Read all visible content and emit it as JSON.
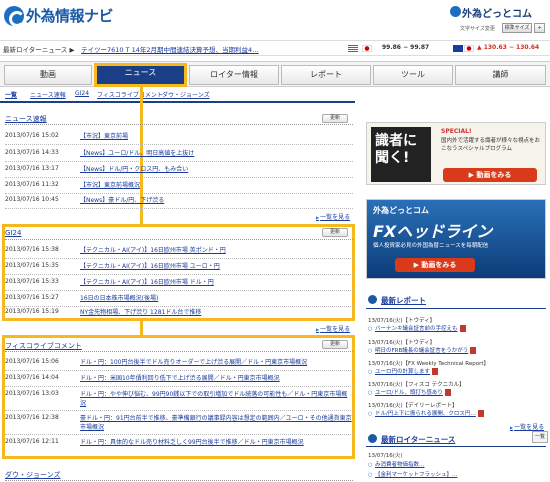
{
  "header": {
    "logo": "外為情報ナビ",
    "brand": "外為どっとコム",
    "fontsize_label": "文字サイズ変更",
    "font_buttons": [
      "標準サイズ",
      "+"
    ]
  },
  "ticker": {
    "label": "最新ロイターニュース ▶",
    "text": "テイツー7610 T 14年2月期中間連結決算予想、当期利益4…",
    "usd_jpy": "99.86 − 99.87",
    "eur_jpy": "▲ 130.63 − 130.64"
  },
  "nav": {
    "tabs": [
      "動画",
      "ニュース",
      "ロイター情報",
      "レポート",
      "ツール",
      "講師"
    ]
  },
  "subnav": [
    "一覧",
    "ニュース速報",
    "GI24",
    "フィスコライブコメント",
    "ダウ・ジョーンズ"
  ],
  "update_label": "更新",
  "sections": [
    {
      "title": "ニュース速報",
      "more": "一覧を見る",
      "rows": [
        {
          "date": "2013/07/16 15:02",
          "text": "【市況】東京前場"
        },
        {
          "date": "2013/07/16 14:33",
          "text": "【News】ユーロ/ドル、明日高値を上抜け"
        },
        {
          "date": "2013/07/16 13:17",
          "text": "【News】ドル/円・クロス円、もみ合い"
        },
        {
          "date": "2013/07/16 11:32",
          "text": "【市況】東京前場概況"
        },
        {
          "date": "2013/07/16 10:45",
          "text": "【News】豪ドル/円、下げ渋る"
        }
      ]
    },
    {
      "title": "GI24",
      "more": "一覧を見る",
      "rows": [
        {
          "date": "2013/07/16 15:38",
          "text": "【テクニカル・AI(アイ)】16日欧州市場 英ポンド・円"
        },
        {
          "date": "2013/07/16 15:35",
          "text": "【テクニカル・AI(アイ)】16日欧州市場 ユーロ・円"
        },
        {
          "date": "2013/07/16 15:33",
          "text": "【テクニカル・AI(アイ)】16日欧州市場 ドル・円"
        },
        {
          "date": "2013/07/16 15:27",
          "text": "16日の日本株市場概況(後場)"
        },
        {
          "date": "2013/07/16 15:19",
          "text": "NY金先物相場、下げ渋り 1281ドル台で推移"
        }
      ]
    },
    {
      "title": "フィスコライブコメント",
      "more": "一覧を見る",
      "rows": [
        {
          "date": "2013/07/16 15:06",
          "text": "ドル・円：100円台後半でドル売りオーダーで上げ渋る展開／ドル・円東京市場概況"
        },
        {
          "date": "2013/07/16 14:04",
          "text": "ドル・円：米国10年債利回り低下で上げ渋る展開／ドル・円東京市場概況"
        },
        {
          "date": "2013/07/16 13:03",
          "text": "ドル・円：やや伸び悩む、99円90銭以下での取引増加でドル続落の可能性も／ドル・円東京市場概況"
        },
        {
          "date": "2013/07/16 12:38",
          "text": "豪ドル・円：91円台前半で推移、豪準備銀行の議事録内容は想定の範囲内／ユーロ・その他通貨東京市場概況"
        },
        {
          "date": "2013/07/16 12:11",
          "text": "ドル・円：具体的なドル売り材料乏しく99円台後半で推移／ドル・円東京市場概況"
        }
      ]
    },
    {
      "title": "ダウ・ジョーンズ",
      "more": "",
      "rows": []
    }
  ],
  "sidebar": {
    "ad1": {
      "title": "識者に聞く!",
      "special": "SPECIAL!",
      "desc": "国内外で活躍する識者が様々な視点をおこなうスペシャルプログラム",
      "button": "▶ 動画をみる"
    },
    "ad2": {
      "brand": "外為どっとコム",
      "title": "FXヘッドライン",
      "desc": "個人投資家必見の外国為替ニュースを毎朝配信",
      "button": "▶ 動画をみる"
    },
    "report_heading": "最新レポート",
    "reports": [
      {
        "date": "13/07/16(火)【トウディ】",
        "title": "バーナンキ議会証言前の手控えも"
      },
      {
        "date": "13/07/16(火)【トウディ】",
        "title": "明日のFRB議長の議会証言をうかがう"
      },
      {
        "date": "13/07/16(火)【FX Weekly Technical Report】",
        "title": "ユーロ円の計算します"
      },
      {
        "date": "13/07/16(火)【フィスコ テクニカル】",
        "title": "ユーロ/ドル、頭打ち感あり"
      },
      {
        "date": "13/07/16(火)【デイリーレポート】",
        "title": "ドル/円上下に振られる展開、クロス円…"
      }
    ],
    "more": "一覧を見る",
    "reuters_heading": "最新ロイターニュース",
    "reuters": [
      "み消費者物価指数…",
      "【金利マーケットフラッシュ】…"
    ],
    "reuters_date": "13/07/16(火)",
    "tag": "一覧"
  }
}
